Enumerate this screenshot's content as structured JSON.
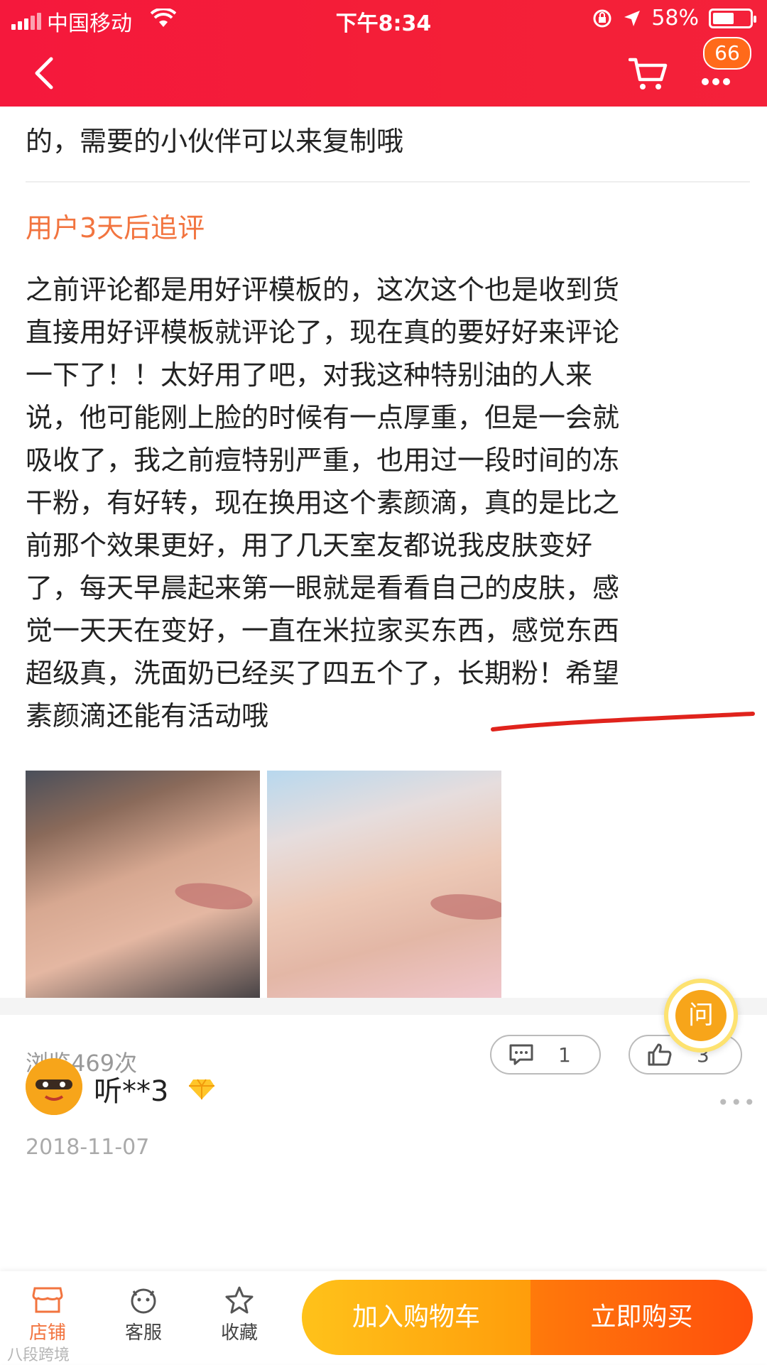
{
  "status_bar": {
    "carrier": "中国移动",
    "time": "下午8:34",
    "battery_percent": "58%",
    "battery_level": 0.58
  },
  "nav": {
    "back_icon": "chevron-left-icon",
    "cart_icon": "shopping-cart-icon",
    "more_icon": "more-dots-icon",
    "badge": "66"
  },
  "review": {
    "previous_line": "的，需要的小伙伴可以来复制哦",
    "followup_title": "用户3天后追评",
    "text_lines": [
      "之前评论都是用好评模板的，这次这个也是收到货",
      "直接用好评模板就评论了，现在真的要好好来评论",
      "一下了！！太好用了吧，对我这种特别油的人来",
      "说，他可能刚上脸的时候有一点厚重，但是一会就",
      "吸收了，我之前痘特别严重，也用过一段时间的冻",
      "干粉，有好转，现在换用这个素颜滴，真的是比之",
      "前那个效果更好，用了几天室友都说我皮肤变好",
      "了，每天早晨起来第一眼就是看看自己的皮肤，感",
      "觉一天天在变好，一直在米拉家买东西，感觉东西",
      "超级真，洗面奶已经买了四五个了，长期粉！希望",
      "素颜滴还能有活动哦"
    ],
    "views": "浏览469次",
    "comment_count": "1",
    "like_count": "3"
  },
  "ask_button": {
    "label": "问"
  },
  "next_review": {
    "username": "听**3",
    "date": "2018-11-07"
  },
  "bottom_bar": {
    "shop_label": "店铺",
    "service_label": "客服",
    "favorite_label": "收藏",
    "add_to_cart": "加入购物车",
    "buy_now": "立即购买"
  },
  "watermark": "八段跨境",
  "colors": {
    "header_red": "#f41f37",
    "followup_orange": "#f2743f",
    "cart_button": "#ffb414",
    "buy_button": "#ff5a0c",
    "badge": "#ff6a1a"
  }
}
